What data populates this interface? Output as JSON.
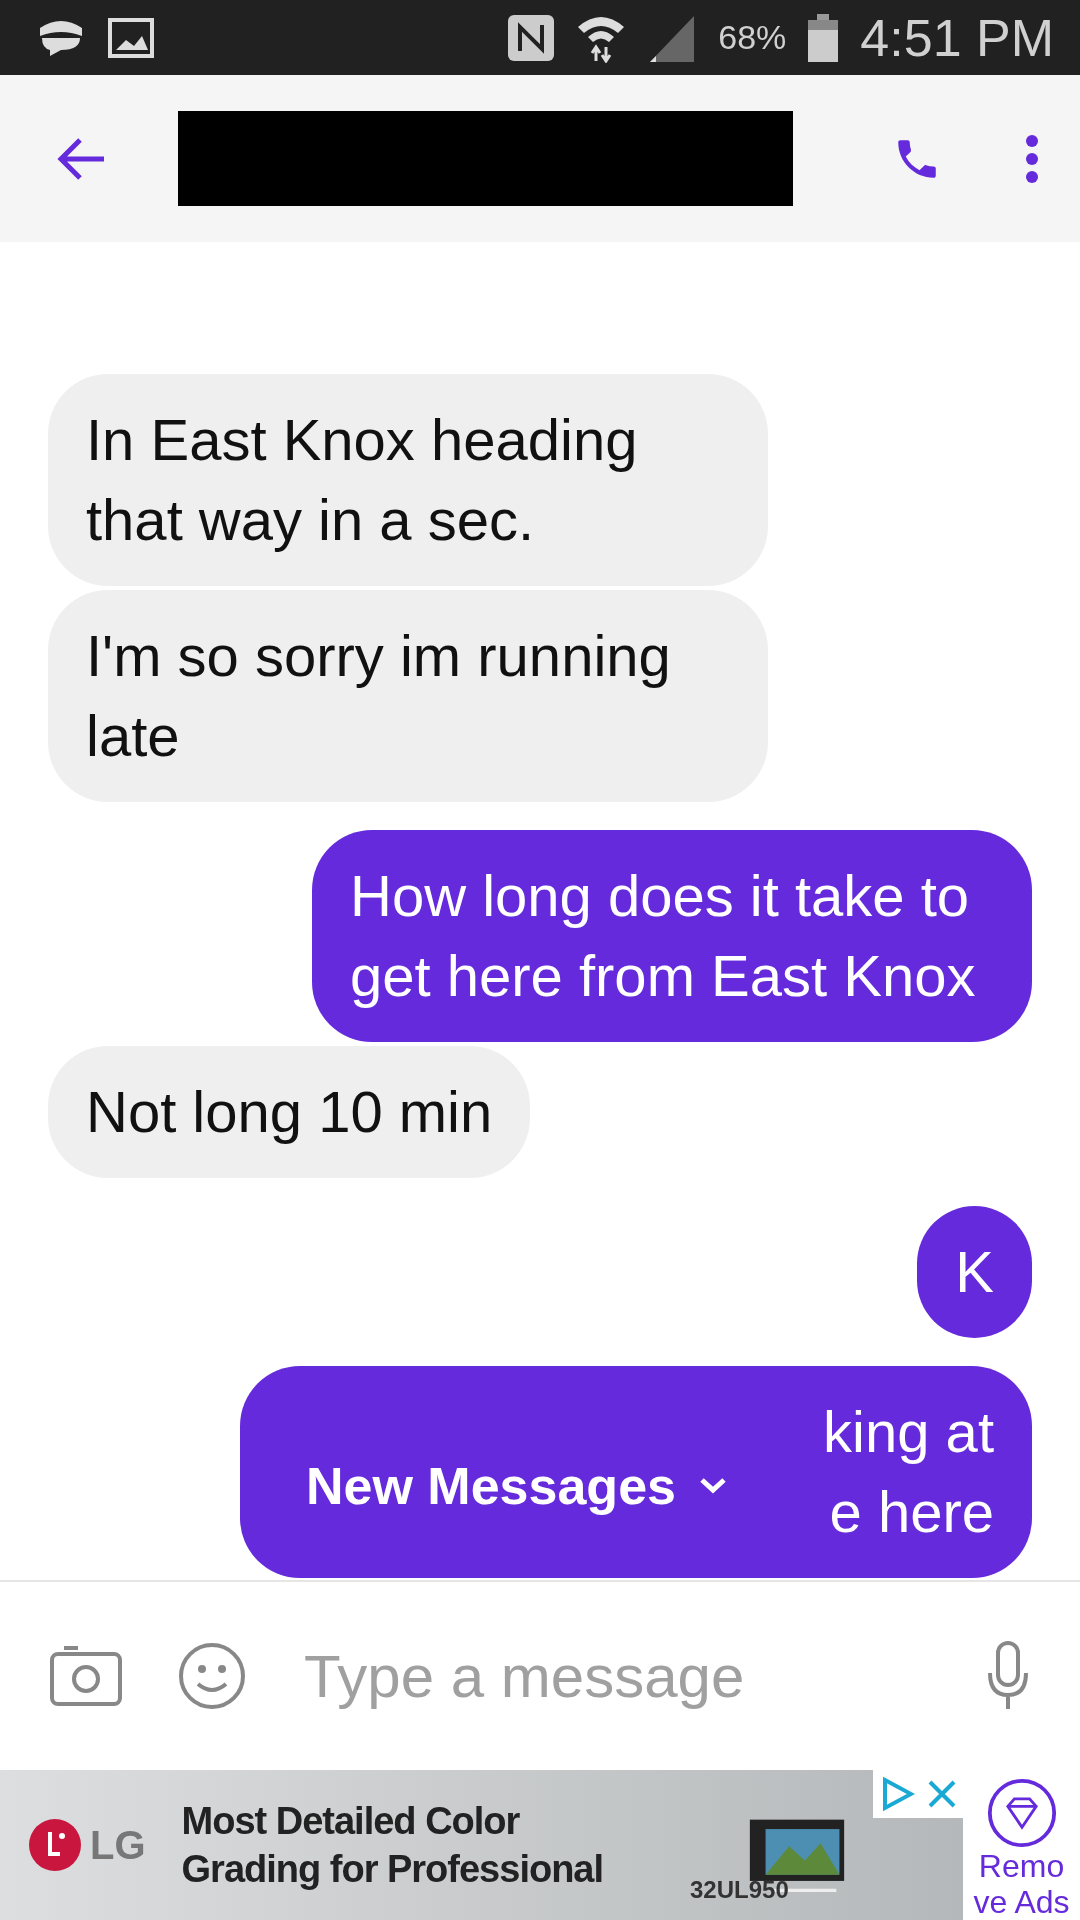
{
  "status_bar": {
    "battery": "68%",
    "time": "4:51 PM"
  },
  "messages": [
    {
      "text": "In East Knox heading that way in a sec.",
      "kind": "received"
    },
    {
      "text": "I'm so sorry im running late",
      "kind": "received"
    },
    {
      "text": "How long does it take to get here from East Knox",
      "kind": "sent"
    },
    {
      "text": "Not long 10 min",
      "kind": "received"
    },
    {
      "text": "K",
      "kind": "sent"
    },
    {
      "text": "king at",
      "tail": "e here",
      "kind": "sent"
    }
  ],
  "new_messages_pill": {
    "label": "New Messages"
  },
  "composer": {
    "placeholder": "Type a message"
  },
  "ad": {
    "headline": "Most Detailed Color Grading for Professional",
    "brand": "LG",
    "model": "32UL950",
    "remove_ads": "Remove Ads"
  }
}
